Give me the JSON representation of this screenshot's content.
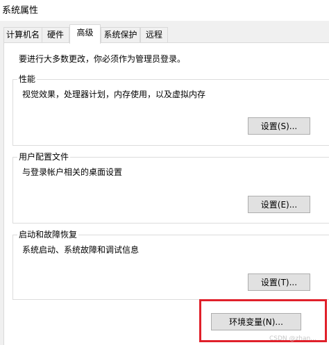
{
  "window": {
    "title": "系统属性"
  },
  "tabs": [
    {
      "label": "计算机名",
      "active": false
    },
    {
      "label": "硬件",
      "active": false
    },
    {
      "label": "高级",
      "active": true
    },
    {
      "label": "系统保护",
      "active": false
    },
    {
      "label": "远程",
      "active": false
    }
  ],
  "advanced": {
    "intro": "要进行大多数更改，你必须作为管理员登录。",
    "performance": {
      "legend": "性能",
      "description": "视觉效果，处理器计划，内存使用，以及虚拟内存",
      "button": "设置(S)..."
    },
    "user_profiles": {
      "legend": "用户配置文件",
      "description": "与登录帐户相关的桌面设置",
      "button": "设置(E)..."
    },
    "startup_recovery": {
      "legend": "启动和故障恢复",
      "description": "系统启动、系统故障和调试信息",
      "button": "设置(T)..."
    },
    "env_button": "环境变量(N)..."
  },
  "watermark": "CSDN @zhan..."
}
